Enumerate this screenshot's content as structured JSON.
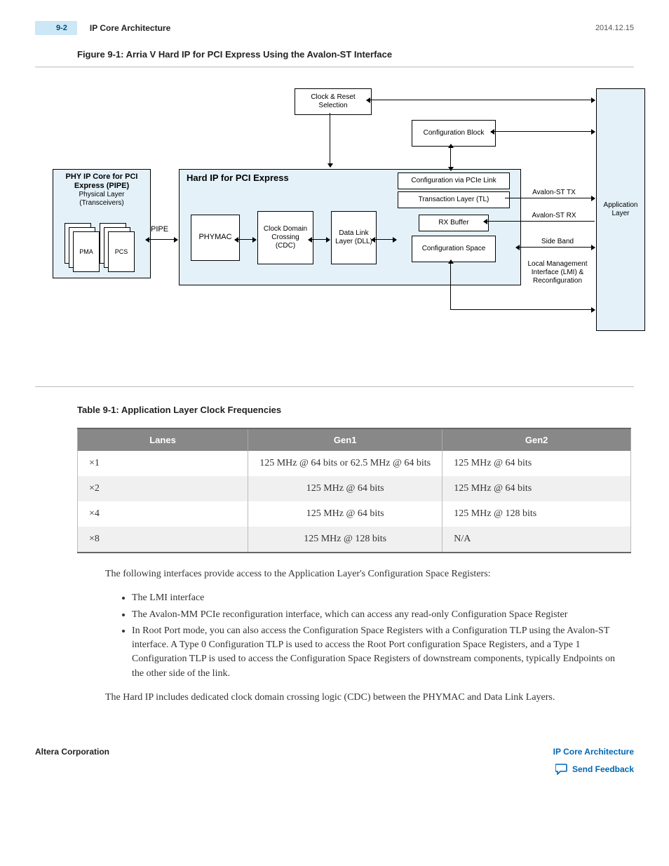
{
  "header": {
    "page_num": "9-2",
    "section": "IP Core Architecture",
    "date": "2014.12.15"
  },
  "figure": {
    "caption": "Figure 9-1: Arria V Hard IP for PCI Express Using the Avalon-ST Interface",
    "phy_title": "PHY IP Core for PCI Express (PIPE)",
    "phy_sub": "Physical Layer (Transceivers)",
    "pma": "PMA",
    "pcs": "PCS",
    "pipe": "PIPE",
    "hardip_title": "Hard IP  for PCI Express",
    "phymac": "PHYMAC",
    "cdc": "Clock Domain Crossing (CDC)",
    "dll": "Data Link Layer (DLL)",
    "clkreset": "Clock & Reset Selection",
    "configblock": "Configuration Block",
    "configvia": "Configuration via PCIe Link",
    "tl": "Transaction Layer (TL)",
    "rxbuf": "RX Buffer",
    "cfgspace": "Configuration Space",
    "avsttx": "Avalon-ST TX",
    "avstrx": "Avalon-ST RX",
    "sideband": "Side Band",
    "lmi": "Local Management Interface (LMI) & Reconfiguration",
    "applayer": "Application Layer"
  },
  "table": {
    "caption": "Table 9-1: Application Layer Clock Frequencies",
    "headers": [
      "Lanes",
      "Gen1",
      "Gen2"
    ],
    "rows": [
      {
        "lanes": "×1",
        "gen1": "125 MHz @ 64 bits or 62.5 MHz @ 64 bits",
        "gen2": "125 MHz @ 64 bits"
      },
      {
        "lanes": "×2",
        "gen1": "125 MHz @ 64 bits",
        "gen2": "125 MHz @ 64 bits"
      },
      {
        "lanes": "×4",
        "gen1": "125 MHz @ 64 bits",
        "gen2": "125 MHz @ 128 bits"
      },
      {
        "lanes": "×8",
        "gen1": "125 MHz @ 128 bits",
        "gen2": "N/A"
      }
    ]
  },
  "body": {
    "intro": "The following interfaces provide access to the Application Layer's Configuration Space Registers:",
    "items": [
      "The LMI interface",
      "The Avalon-MM PCIe reconfiguration interface, which can access any read-only Configuration Space Register",
      "In Root Port mode, you can also access the Configuration Space Registers with a Configuration TLP using the Avalon-ST interface. A Type 0 Configuration TLP is used to access the Root Port configuration Space Registers, and a Type 1 Configuration TLP is used to access the Configuration Space Registers of downstream components, typically Endpoints on the other side of the link."
    ],
    "closing": "The Hard IP includes dedicated clock domain crossing logic (CDC) between the PHYMAC and Data Link Layers."
  },
  "footer": {
    "left": "Altera Corporation",
    "link1": "IP Core Architecture",
    "link2": "Send Feedback"
  }
}
